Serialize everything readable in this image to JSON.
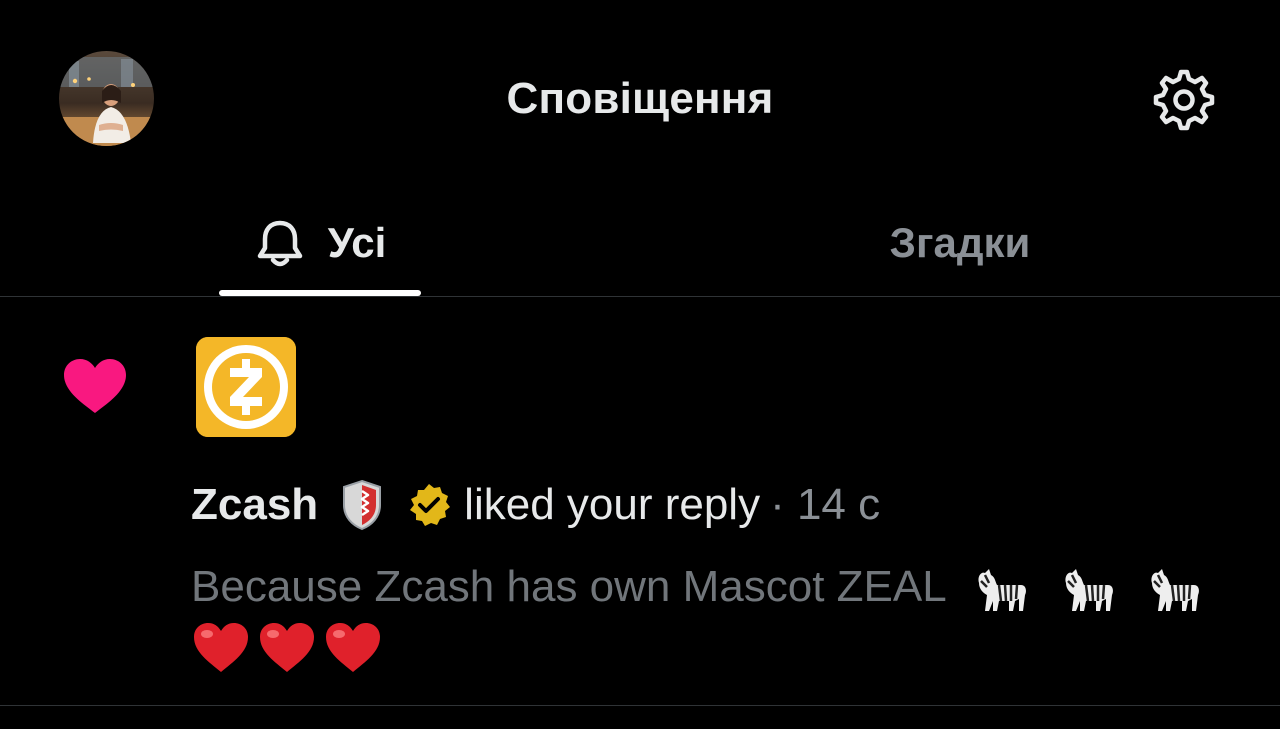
{
  "header": {
    "title": "Сповіщення",
    "settings_icon": "gear-icon",
    "avatar_icon": "profile-avatar"
  },
  "tabs": [
    {
      "label": "Усі",
      "icon": "bell-icon",
      "active": true
    },
    {
      "label": "Згадки",
      "active": false
    }
  ],
  "notification": {
    "type_icon": "heart-icon",
    "account_avatar": "zcash-logo",
    "user_name": "Zcash",
    "badges": [
      "shield-icon",
      "verified-gold-badge-icon"
    ],
    "action": "liked your reply",
    "time": "· 14 с",
    "reply_text": "Because Zcash has own Mascot ZEAL",
    "reply_emojis": [
      "zebra-icon",
      "zebra-icon",
      "zebra-icon",
      "red-heart-icon",
      "red-heart-icon",
      "red-heart-icon"
    ]
  },
  "colors": {
    "background": "#000000",
    "primary_text": "#e7e9ea",
    "secondary_text": "#71767b",
    "like_pink": "#f91880",
    "zcash_gold": "#f4b728",
    "verified_gold": "#e2b719",
    "divider": "#2f3336"
  }
}
